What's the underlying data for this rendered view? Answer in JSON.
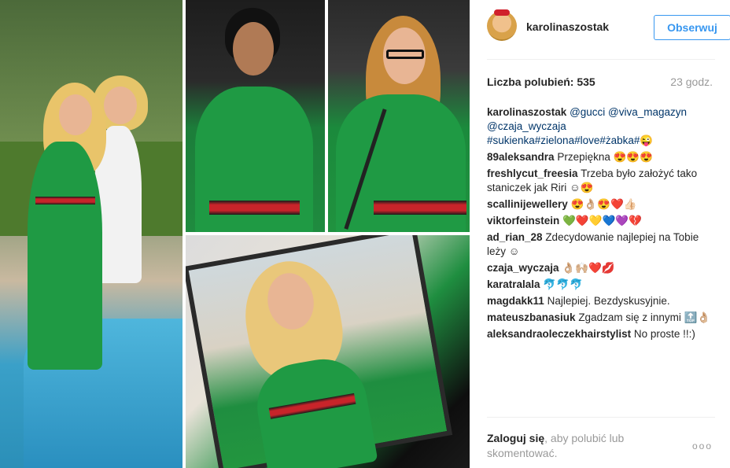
{
  "post": {
    "username": "karolinaszostak",
    "follow_label": "Obserwuj",
    "likes_text": "Liczba polubień: 535",
    "time_ago": "23 godz."
  },
  "caption": {
    "user": "karolinaszostak",
    "line1": "@gucci @viva_magazyn",
    "line2": "@czaja_wyczaja",
    "line3": "#sukienka#zielona#love#żabka#😜"
  },
  "comments": [
    {
      "user": "89aleksandra",
      "text": "Przepiękna 😍😍😍"
    },
    {
      "user": "freshlycut_freesia",
      "text": "Trzeba było założyć tako staniczek jak Riri ☺😍"
    },
    {
      "user": "scallinijewellery",
      "text": "😍👌🏼😍❤️👍🏻"
    },
    {
      "user": "viktorfeinstein",
      "text": "💚❤️💛💙💜💔"
    },
    {
      "user": "ad_rian_28",
      "text": "Zdecydowanie najlepiej na Tobie leży ☺"
    },
    {
      "user": "czaja_wyczaja",
      "text": "👌🏼🙌🏼❤️💋"
    },
    {
      "user": "karatralala",
      "text": "🐬🐬🐬"
    },
    {
      "user": "magdakk11",
      "text": "Najlepiej. Bezdyskusyjnie."
    },
    {
      "user": "mateuszbanasiuk",
      "text": "Zgadzam się z innymi 🔝👌🏼"
    },
    {
      "user": "aleksandraoleczekhairstylist",
      "text": "No proste !!:)"
    }
  ],
  "footer": {
    "login_link": "Zaloguj się",
    "login_rest": ", aby polubić lub skomentować.",
    "more": "ooo"
  },
  "colors": {
    "accent": "#3897f0",
    "text": "#262626",
    "muted": "#999999",
    "dress_green": "#1f9a44",
    "belt_red": "#c8242a"
  }
}
